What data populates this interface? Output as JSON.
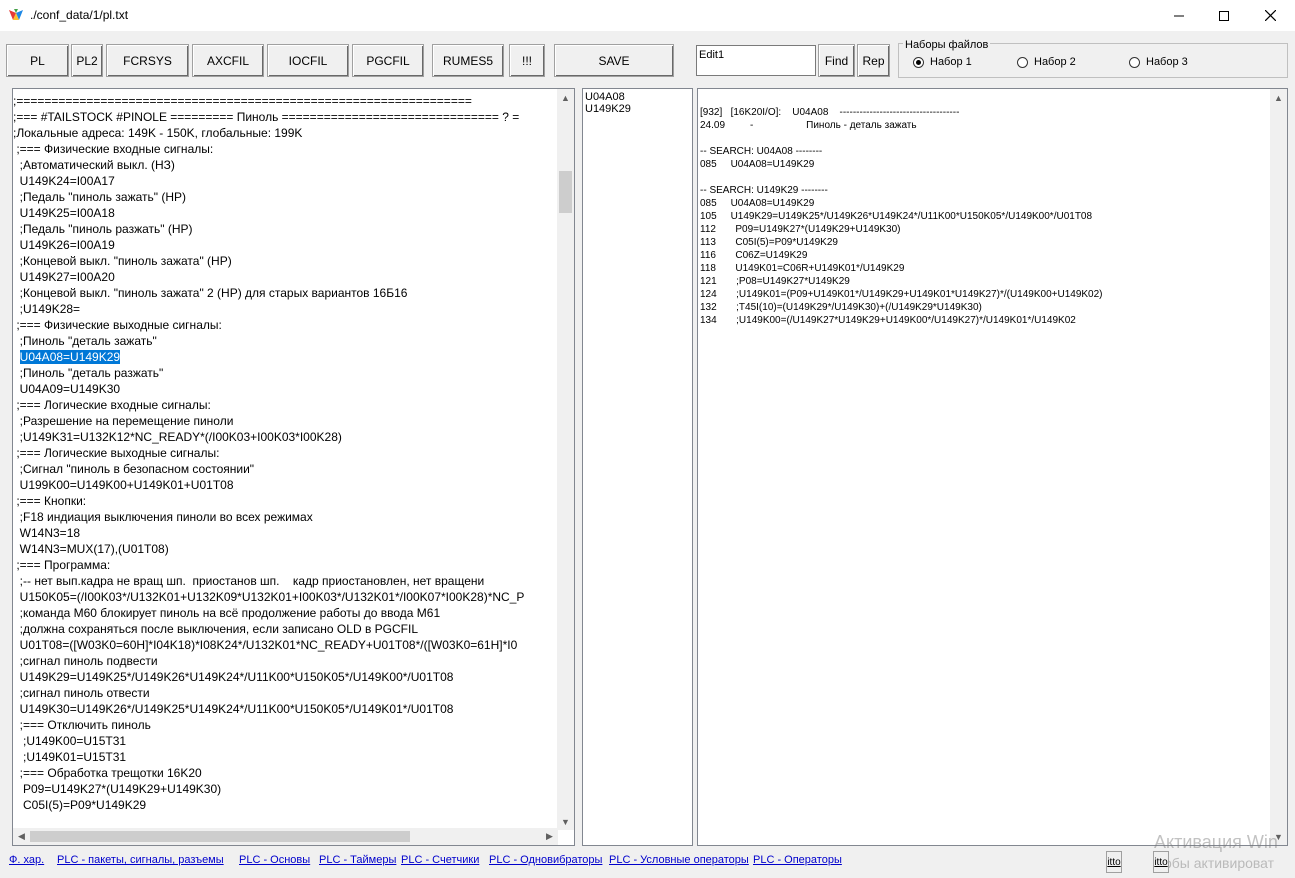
{
  "window": {
    "title": "./conf_data/1/pl.txt"
  },
  "toolbar": {
    "buttons": [
      "PL",
      "PL2",
      "FCRSYS",
      "AXCFIL",
      "IOCFIL",
      "PGCFIL",
      "RUMES5",
      "!!!",
      "SAVE"
    ],
    "edit_value": "Edit1",
    "find_label": "Find",
    "rep_label": "Rep",
    "group_label": "Наборы файлов",
    "radios": [
      "Набор 1",
      "Набор 2",
      "Набор 3"
    ],
    "selected_radio": "Набор 1"
  },
  "code_lines": [
    ";=================================================================",
    ";=== #TAILSTOCK #PINOLE ========= Пиноль =============================== ? =",
    ";Локальные адреса: 149K - 150K, глобальные: 199K",
    " ;=== Физические входные сигналы:",
    "  ;Автоматический выкл. (НЗ)",
    "  U149K24=I00A17",
    "  ;Педаль \"пиноль зажать\" (НР)",
    "  U149K25=I00A18",
    "  ;Педаль \"пиноль разжать\" (НР)",
    "  U149K26=I00A19",
    "  ;Концевой выкл. \"пиноль зажата\" (НР)",
    "  U149K27=I00A20",
    "  ;Концевой выкл. \"пиноль зажата\" 2 (НР) для старых вариантов 16Б16",
    "  ;U149K28=",
    " ;=== Физические выходные сигналы:",
    "  ;Пиноль \"деталь зажать\"",
    "  U04A08=U149K29",
    "  ;Пиноль \"деталь разжать\"",
    "  U04A09=U149K30",
    " ;=== Логические входные сигналы:",
    "  ;Разрешение на перемещение пиноли",
    "  ;U149K31=U132K12*NC_READY*(/I00K03+I00K03*I00K28)",
    " ;=== Логические выходные сигналы:",
    "  ;Сигнал \"пиноль в безопасном состоянии\"",
    "  U199K00=U149K00+U149K01+U01T08",
    " ;=== Кнопки:",
    "  ;F18 индиация выключения пиноли во всех режимах",
    "  W14N3=18",
    "  W14N3=MUX(17),(U01T08)",
    " ;=== Программа:",
    "  ;-- нет вып.кадра не вращ шп.  приостанов шп.    кадр приостановлен, нет вращени",
    "  U150K05=(/I00K03*/U132K01+U132K09*U132K01+I00K03*/U132K01*/I00K07*I00K28)*NC_P",
    "  ;команда M60 блокирует пиноль на всё продолжение работы до ввода M61",
    "  ;должна сохраняться после выключения, если записано OLD в PGCFIL",
    "  U01T08=([W03K0=60H]*I04K18)*I08K24*/U132K01*NC_READY+U01T08*/([W03K0=61H]*I0",
    "  ;сигнал пиноль подвести",
    "  U149K29=U149K25*/U149K26*U149K24*/U11K00*U150K05*/U149K00*/U01T08",
    "  ;сигнал пиноль отвести",
    "  U149K30=U149K26*/U149K25*U149K24*/U11K00*U150K05*/U149K01*/U01T08",
    "  ;=== Отключить пиноль",
    "   ;U149K00=U15T31",
    "   ;U149K01=U15T31",
    "  ;=== Обработка трещотки 16K20",
    "   P09=U149K27*(U149K29+U149K30)",
    "   C05I(5)=P09*U149K29"
  ],
  "highlighted_line": "U04A08=U149K29",
  "list_items": [
    "U04A08",
    "U149K29"
  ],
  "search_lines": [
    "[932]   [16K20I/O]:    U04A08    ------------------------------------",
    "24.09         -                   Пиноль - деталь зажать",
    "",
    "-- SEARCH: U04A08 --------",
    "085     U04A08=U149K29",
    "",
    "-- SEARCH: U149K29 --------",
    "085     U04A08=U149K29",
    "105     U149K29=U149K25*/U149K26*U149K24*/U11K00*U150K05*/U149K00*/U01T08",
    "112       P09=U149K27*(U149K29+U149K30)",
    "113       C05I(5)=P09*U149K29",
    "116       C06Z=U149K29",
    "118       U149K01=C06R+U149K01*/U149K29",
    "121       ;P08=U149K27*U149K29",
    "124       ;U149K01=(P09+U149K01*/U149K29+U149K01*U149K27)*/(U149K00+U149K02)",
    "132       ;T45I(10)=(U149K29*/U149K30)+(/U149K29*U149K30)",
    "134       ;U149K00=(/U149K27*U149K29+U149K00*/U149K27)*/U149K01*/U149K02"
  ],
  "footer_links": [
    "Ф. хар.",
    "PLC - пакеты, сигналы, разъемы",
    "PLC - Основы",
    "PLC - Таймеры",
    "PLC - Счетчики",
    "PLC - Одновибраторы",
    "PLC - Условные операторы",
    "PLC - Операторы"
  ],
  "footer_fields": [
    "itto",
    "itto"
  ],
  "watermark": {
    "line1": "Активация Win",
    "line2": "обы активироват"
  }
}
